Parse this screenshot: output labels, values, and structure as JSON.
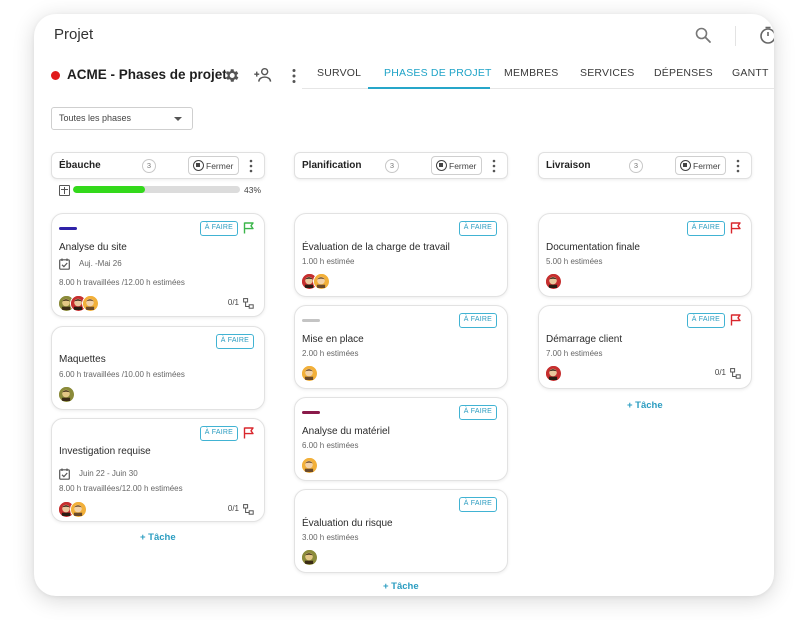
{
  "app": {
    "title": "Projet"
  },
  "project": {
    "name": "ACME - Phases de projet",
    "status_color": "#e01b1b"
  },
  "tabs": [
    "SURVOL",
    "PHASES DE PROJET",
    "MEMBRES",
    "SERVICES",
    "DÉPENSES",
    "GANTT"
  ],
  "active_tab": "PHASES DE PROJET",
  "filter": {
    "value": "Toutes les phases"
  },
  "close_label": "Fermer",
  "add_task_label": "+ Tâche",
  "colors": {
    "accent": "#26a6c9",
    "progress": "#33d91b",
    "flag_green": "#3bb54a",
    "flag_red": "#d9262c"
  },
  "columns": [
    {
      "name": "Ébauche",
      "count": "3",
      "progress": {
        "percent": 43,
        "label": "43%"
      },
      "cards": [
        {
          "stripe": "#2f22a8",
          "badge": "À FAIRE",
          "flag": "green",
          "title": "Analyse du site",
          "date": "Auj. -Mai 26",
          "hours": "8.00 h travaillées /12.00 h estimées",
          "subtasks": "0/1",
          "avatars": [
            "olive",
            "red",
            "yellow"
          ]
        },
        {
          "badge": "À FAIRE",
          "title": "Maquettes",
          "hours": "6.00 h travaillées /10.00 h estimées",
          "avatars": [
            "olive"
          ]
        },
        {
          "badge": "À FAIRE",
          "flag": "red",
          "title": "Investigation requise",
          "date": "Juin 22 - Juin 30",
          "hours": "8.00 h travaillées/12.00 h estimées",
          "subtasks": "0/1",
          "avatars": [
            "red",
            "yellow"
          ]
        }
      ]
    },
    {
      "name": "Planification",
      "count": "3",
      "cards": [
        {
          "badge": "À FAIRE",
          "title": "Évaluation de la charge de travail",
          "hours": "1.00 h estimée",
          "avatars": [
            "red",
            "yellow"
          ]
        },
        {
          "stripe": "#c4c4c4",
          "badge": "À FAIRE",
          "title": "Mise en place",
          "hours": "2.00 h estimées",
          "avatars": [
            "yellow"
          ]
        },
        {
          "stripe": "#8a1a4a",
          "badge": "À FAIRE",
          "title": "Analyse du matériel",
          "hours": "6.00 h estimées",
          "avatars": [
            "yellow"
          ]
        },
        {
          "badge": "À FAIRE",
          "title": "Évaluation du risque",
          "hours": "3.00 h estimées",
          "avatars": [
            "olive"
          ]
        }
      ]
    },
    {
      "name": "Livraison",
      "count": "3",
      "cards": [
        {
          "badge": "À FAIRE",
          "flag": "red",
          "title": "Documentation finale",
          "hours": "5.00 h estimées",
          "avatars": [
            "red"
          ]
        },
        {
          "badge": "À FAIRE",
          "flag": "red",
          "title": "Démarrage client",
          "hours": "7.00 h estimées",
          "subtasks": "0/1",
          "avatars": [
            "red"
          ]
        }
      ]
    }
  ]
}
